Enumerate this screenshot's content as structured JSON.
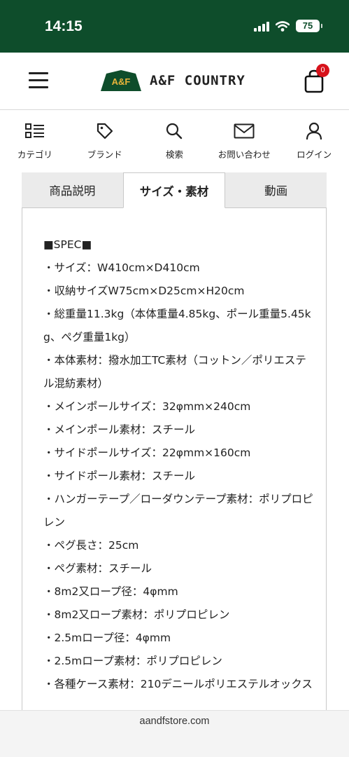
{
  "status_bar": {
    "time": "14:15",
    "battery_level": "75"
  },
  "header": {
    "logo_badge": "A&F",
    "logo_text": "A&F COUNTRY",
    "cart_count": "0"
  },
  "nav": {
    "items": [
      {
        "label": "カテゴリ",
        "icon": "category-list-icon"
      },
      {
        "label": "ブランド",
        "icon": "tag-icon"
      },
      {
        "label": "検索",
        "icon": "search-icon"
      },
      {
        "label": "お問い合わせ",
        "icon": "mail-icon"
      },
      {
        "label": "ログイン",
        "icon": "user-icon"
      }
    ]
  },
  "tabs": [
    {
      "label": "商品説明",
      "active": false
    },
    {
      "label": "サイズ・素材",
      "active": true
    },
    {
      "label": "動画",
      "active": false
    }
  ],
  "spec": {
    "lines": [
      "■SPEC■",
      "・サイズ：W410cm×D410cm",
      "・収納サイズW75cm×D25cm×H20cm",
      "・総重量11.3kg（本体重量4.85kg、ポール重量5.45kg、ペグ重量1kg）",
      "・本体素材：撥水加工TC素材（コットン／ポリエステル混紡素材）",
      "・メインポールサイズ：32φmm×240cm",
      "・メインポール素材：スチール",
      "・サイドポールサイズ：22φmm×160cm",
      "・サイドポール素材：スチール",
      "・ハンガーテープ／ローダウンテープ素材：ポリプロピレン",
      "・ペグ長さ：25cm",
      "・ペグ素材：スチール",
      "・8m2又ロープ径：4φmm",
      "・8m2又ロープ素材：ポリプロピレン",
      "・2.5mロープ径：4φmm",
      "・2.5mロープ素材：ポリプロピレン",
      "・各種ケース素材：210デニールポリエステルオックス"
    ]
  },
  "browser": {
    "url": "aandfstore.com"
  }
}
